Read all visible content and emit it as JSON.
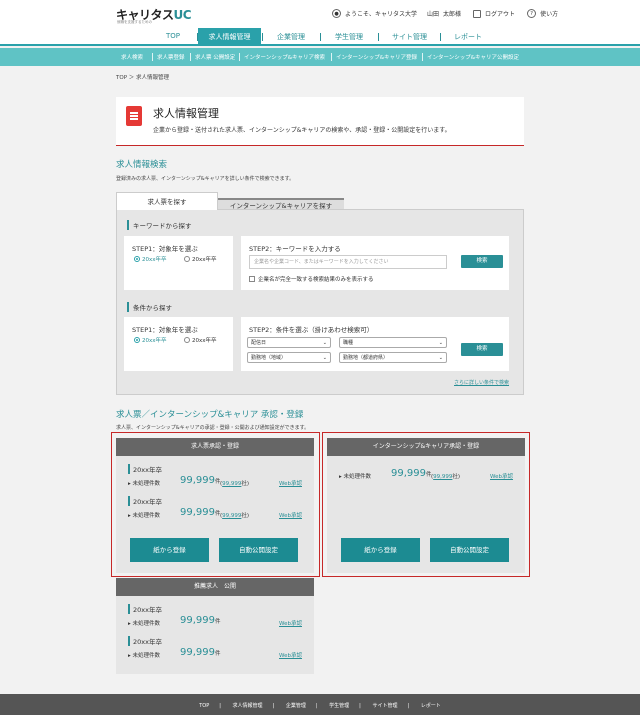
{
  "header": {
    "logo_main": "キャリタス",
    "logo_uc": "UC",
    "logo_sub": "就職を支援するための",
    "welcome": "ようこそ、キャリタス大学",
    "user_last": "山田",
    "user_first": "太郎様",
    "logout": "ログアウト",
    "help": "使い方"
  },
  "nav": {
    "top": "TOP",
    "job": "求人情報管理",
    "company": "企業管理",
    "student": "学生管理",
    "site": "サイト管理",
    "report": "レポート"
  },
  "subnav": {
    "items": [
      "求人検索",
      "求人票登録",
      "求人票 公開設定",
      "インターンシップ&キャリア検索",
      "インターンシップ&キャリア登録",
      "インターンシップ&キャリア公開設定"
    ]
  },
  "breadcrumb": "TOP ＞ 求人情報管理",
  "title": {
    "heading": "求人情報管理",
    "desc": "企業から登録・送付された求人票、インターンシップ&キャリアの検索や、承認・登録・公開設定を行います。"
  },
  "search": {
    "title": "求人情報検索",
    "desc": "登録済みの求人票、インターンシップ&キャリアを詳しい条件で検索できます。",
    "tab_active": "求人票を探す",
    "tab_inactive": "インターンシップ&キャリアを探す",
    "keyword": {
      "head": "キーワードから探す",
      "step1": "STEP1：対象年を選ぶ",
      "radio1": "20xx年卒",
      "radio2": "20xx年卒",
      "step2": "STEP2：キーワードを入力する",
      "placeholder": "企業名や企業コード、またはキーワードを入力してください",
      "btn": "検索",
      "checkbox": "企業名が完全一致する検索結果のみを表示する"
    },
    "condition": {
      "head": "条件から探す",
      "step1": "STEP1：対象年を選ぶ",
      "radio1": "20xx年卒",
      "radio2": "20xx年卒",
      "step2": "STEP2：条件を選ぶ（掛けあわせ検索可）",
      "sel1": "配信日",
      "sel2": "職種",
      "sel3": "勤務地（地域）",
      "sel4": "勤務地（都道府県）",
      "btn": "検索",
      "more": "さらに詳しい条件で検索"
    }
  },
  "approval": {
    "title": "求人票／インターンシップ&キャリア 承認・登録",
    "desc": "求人票、インターンシップ&キャリアの承認・登録・公開および通知設定ができます。",
    "card1": {
      "head": "求人票承認・登録",
      "year1": "20xx年卒",
      "label1": "未処理件数",
      "num1": "99,999",
      "unit1": "件",
      "sub1_open": "(",
      "sub1_num": "99,999",
      "sub1_close": "社)",
      "link1": "Web承認",
      "year2": "20xx年卒",
      "label2": "未処理件数",
      "num2": "99,999",
      "unit2": "件",
      "sub2_open": "(",
      "sub2_num": "99,999",
      "sub2_close": "社)",
      "link2": "Web承認",
      "btn1": "紙から登録",
      "btn2": "自動公開設定"
    },
    "card2": {
      "head": "インターンシップ&キャリア承認・登録",
      "label1": "未処理件数",
      "num1": "99,999",
      "unit1": "件",
      "sub1_open": "(",
      "sub1_num": "99,999",
      "sub1_close": "社)",
      "link1": "Web承認",
      "btn1": "紙から登録",
      "btn2": "自動公開設定"
    },
    "card3": {
      "head": "推薦求人　公開",
      "year1": "20xx年卒",
      "label1": "未処理件数",
      "num1": "99,999",
      "unit1": "件",
      "link1": "Web承認",
      "year2": "20xx年卒",
      "label2": "未処理件数",
      "num2": "99,999",
      "unit2": "件",
      "link2": "Web承認"
    }
  },
  "footer": {
    "items": [
      "TOP",
      "求人情報管理",
      "企業管理",
      "学生管理",
      "サイト管理",
      "レポート"
    ],
    "sep": "|"
  }
}
